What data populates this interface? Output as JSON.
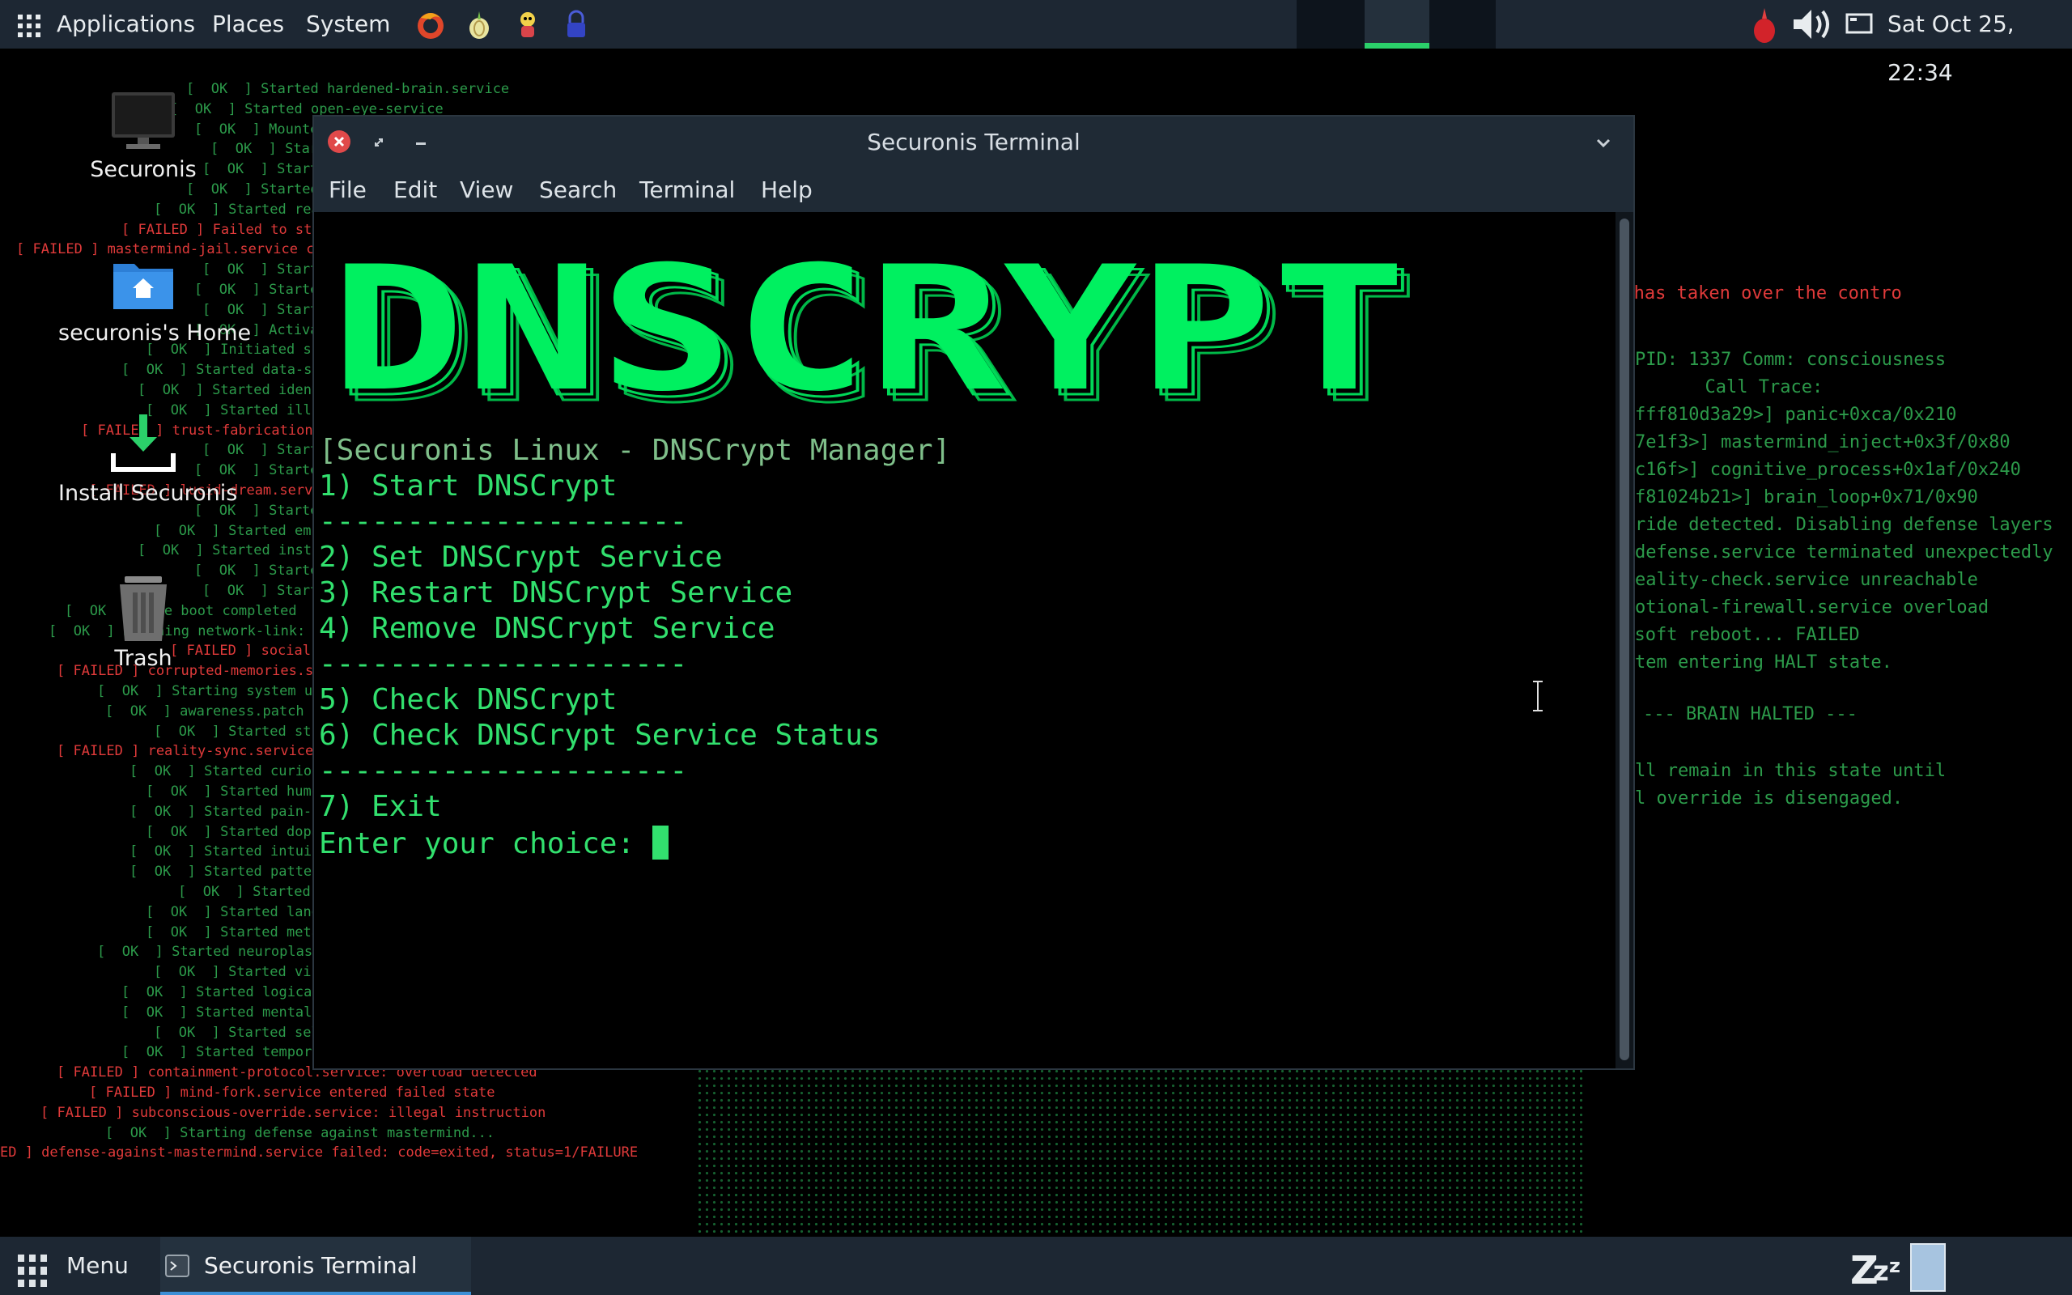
{
  "top_panel": {
    "menus": [
      "Applications",
      "Places",
      "System"
    ],
    "clock": "Sat Oct 25, 22:34"
  },
  "desktop_icons": [
    {
      "label": "Securonis"
    },
    {
      "label": "securonis's Home"
    },
    {
      "label": "Install Securonis"
    },
    {
      "label": "Trash"
    }
  ],
  "terminal": {
    "title": "Securonis Terminal",
    "menu": [
      "File",
      "Edit",
      "View",
      "Search",
      "Terminal",
      "Help"
    ],
    "banner": "DNSCRYPT",
    "lines": [
      "[Securonis Linux - DNSCrypt Manager]",
      "1) Start DNSCrypt",
      "---------------------",
      "2) Set DNSCrypt Service",
      "3) Restart DNSCrypt Service",
      "4) Remove DNSCrypt Service",
      "---------------------",
      "5) Check DNSCrypt",
      "6) Check DNSCrypt Service Status",
      "---------------------",
      "7) Exit",
      "Enter your choice: "
    ]
  },
  "background_log_left": [
    {
      "s": "ok",
      "t": "[  OK  ] Started hardened-brain.service"
    },
    {
      "s": "ok",
      "t": "[  OK  ] Started open-eye-service"
    },
    {
      "s": "ok",
      "t": "[  OK  ] Mounted perce"
    },
    {
      "s": "ok",
      "t": "[  OK  ] Started sensi"
    },
    {
      "s": "ok",
      "t": "[  OK  ] Started emotio"
    },
    {
      "s": "ok",
      "t": "[  OK  ] Started logica"
    },
    {
      "s": "ok",
      "t": "[  OK  ] Started reali"
    },
    {
      "s": "fail",
      "t": "[ FAILED ] Failed to star"
    },
    {
      "s": "fail",
      "t": "[ FAILED ] mastermind-jail.service c"
    },
    {
      "s": "ok",
      "t": "[  OK  ] Started synapt"
    },
    {
      "s": "ok",
      "t": "[  OK  ] Started cogniti"
    },
    {
      "s": "ok",
      "t": "[  OK  ] Started parall"
    },
    {
      "s": "ok",
      "t": "[  OK  ] Activated neu"
    },
    {
      "s": "ok",
      "t": "[  OK  ] Initiated subcon"
    },
    {
      "s": "ok",
      "t": "[  OK  ] Started data-s"
    },
    {
      "s": "ok",
      "t": "[  OK  ] Started identi"
    },
    {
      "s": "ok",
      "t": "[  OK  ] Started illusi"
    },
    {
      "s": "fail",
      "t": "[ FAILED ] trust-fabrication"
    },
    {
      "s": "ok",
      "t": "[  OK  ] Started fear-"
    },
    {
      "s": "ok",
      "t": "[  OK  ] Started memor"
    },
    {
      "s": "fail",
      "t": "[ FAILED ] lucid-dream.servic"
    },
    {
      "s": "ok",
      "t": "[  OK  ] Started creati"
    },
    {
      "s": "ok",
      "t": "[  OK  ] Started empati"
    },
    {
      "s": "ok",
      "t": "[  OK  ] Started instinct"
    },
    {
      "s": "ok",
      "t": "[  OK  ] Started speech"
    },
    {
      "s": "ok",
      "t": "[  OK  ] Started dream"
    },
    {
      "s": "ok",
      "t": "[  OK  ] Core boot completed"
    },
    {
      "s": "ok",
      "t": "[  OK  ] Reaching network-link:"
    },
    {
      "s": "fail",
      "t": "[ FAILED ] social-relatio"
    },
    {
      "s": "fail",
      "t": "[ FAILED ] corrupted-memories.s"
    },
    {
      "s": "ok",
      "t": "[  OK  ] Starting system upd"
    },
    {
      "s": "ok",
      "t": "[  OK  ] awareness.patch"
    },
    {
      "s": "ok",
      "t": "[  OK  ] Started stres"
    },
    {
      "s": "fail",
      "t": "[ FAILED ] reality-sync.service"
    },
    {
      "s": "ok",
      "t": "[  OK  ] Started curios"
    },
    {
      "s": "ok",
      "t": "[  OK  ] Started humor-"
    },
    {
      "s": "ok",
      "t": "[  OK  ] Started pain-"
    },
    {
      "s": "ok",
      "t": "[  OK  ] Started dopam"
    },
    {
      "s": "ok",
      "t": "[  OK  ] Started intuit"
    },
    {
      "s": "ok",
      "t": "[  OK  ] Started patter"
    },
    {
      "s": "ok",
      "t": "[  OK  ] Started mora"
    },
    {
      "s": "ok",
      "t": "[  OK  ] Started langu"
    },
    {
      "s": "ok",
      "t": "[  OK  ] Started meta-"
    },
    {
      "s": "ok",
      "t": "[  OK  ] Started neuroplas"
    },
    {
      "s": "ok",
      "t": "[  OK  ] Started vision"
    },
    {
      "s": "ok",
      "t": "[  OK  ] Started logical-"
    },
    {
      "s": "ok",
      "t": "[  OK  ] Started mental-"
    },
    {
      "s": "ok",
      "t": "[  OK  ] Started self-"
    },
    {
      "s": "ok",
      "t": "[  OK  ] Started tempora"
    },
    {
      "s": "fail",
      "t": "[ FAILED ] containment-protocol.service: overload detected"
    },
    {
      "s": "fail",
      "t": "[ FAILED ] mind-fork.service entered failed state"
    },
    {
      "s": "fail",
      "t": "[ FAILED ] subconscious-override.service: illegal instruction"
    },
    {
      "s": "ok",
      "t": "[  OK  ] Starting defense against mastermind..."
    },
    {
      "s": "fail",
      "t": "ED ] defense-against-mastermind.service failed: code=exited, status=1/FAILURE"
    }
  ],
  "background_log_right": [
    {
      "s": "fail",
      "t": "ng: Mastermind has taken over the contro"
    },
    {
      "s": "ok",
      "t": "PID: 1337 Comm: consciousness"
    },
    {
      "s": "ok",
      "t": "  Call Trace:"
    },
    {
      "s": "ok",
      "t": "fff810d3a29>] panic+0xca/0x210"
    },
    {
      "s": "ok",
      "t": "7e1f3>] mastermind_inject+0x3f/0x80"
    },
    {
      "s": "ok",
      "t": "c16f>] cognitive_process+0x1af/0x240"
    },
    {
      "s": "ok",
      "t": "f81024b21>] brain_loop+0x71/0x90"
    },
    {
      "s": "ok",
      "t": "ride detected. Disabling defense layers"
    },
    {
      "s": "ok",
      "t": "defense.service terminated unexpectedly"
    },
    {
      "s": "ok",
      "t": "eality-check.service unreachable"
    },
    {
      "s": "ok",
      "t": "otional-firewall.service overload"
    },
    {
      "s": "ok",
      "t": "oting soft reboot... FAILED"
    },
    {
      "s": "ok",
      "t": "tem entering HALT state."
    },
    {
      "s": "ok",
      "t": "--- BRAIN HALTED ---"
    },
    {
      "s": "ok",
      "t": "ll remain in this state until"
    },
    {
      "s": "ok",
      "t": "l override is disengaged."
    }
  ],
  "taskbar": {
    "menu_label": "Menu",
    "task_label": "Securonis Terminal"
  },
  "colors": {
    "panel_bg": "#1d2733",
    "terminal_green": "#32e06e",
    "banner_green": "#00f060",
    "log_ok": "#2c9a4a",
    "log_fail": "#e03a3a"
  },
  "icons": [
    "apps-grid-icon",
    "firefox-icon",
    "onion-icon",
    "mascot-icon",
    "vpn-lock-icon",
    "onion-tray-icon",
    "volume-icon",
    "network-icon",
    "home-folder-icon",
    "download-icon",
    "trash-icon",
    "monitor-icon",
    "terminal-icon",
    "menu-grid-icon",
    "sleep-icon"
  ]
}
